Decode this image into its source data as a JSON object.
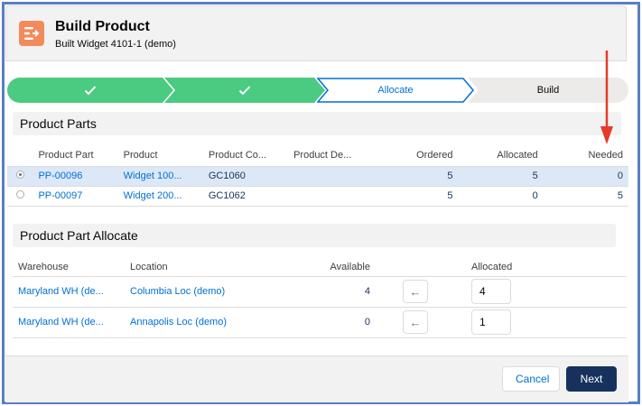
{
  "header": {
    "title": "Build Product",
    "subtitle": "Built Widget 4101-1 (demo)",
    "icon": "build-product-icon"
  },
  "path": {
    "stages": [
      {
        "label": "",
        "state": "complete"
      },
      {
        "label": "",
        "state": "complete"
      },
      {
        "label": "Allocate",
        "state": "current"
      },
      {
        "label": "Build",
        "state": "incomplete"
      }
    ],
    "colors": {
      "complete": "#4bca81",
      "current_border": "#0070d2",
      "incomplete": "#ecebea"
    }
  },
  "parts": {
    "title": "Product Parts",
    "columns": [
      "Product Part",
      "Product",
      "Product Co...",
      "Product De...",
      "Ordered",
      "Allocated",
      "Needed"
    ],
    "rows": [
      {
        "selected": true,
        "part": "PP-00096",
        "product": "Widget 100...",
        "code": "GC1060",
        "desc": "",
        "ordered": "5",
        "allocated": "5",
        "needed": "0"
      },
      {
        "selected": false,
        "part": "PP-00097",
        "product": "Widget 200...",
        "code": "GC1062",
        "desc": "",
        "ordered": "5",
        "allocated": "0",
        "needed": "5"
      }
    ]
  },
  "allocate": {
    "title": "Product Part Allocate",
    "columns": [
      "Warehouse",
      "Location",
      "Available",
      "Allocated"
    ],
    "rows": [
      {
        "warehouse": "Maryland WH (de...",
        "location": "Columbia Loc (demo)",
        "available": "4",
        "qty": "4"
      },
      {
        "warehouse": "Maryland WH (de...",
        "location": "Annapolis Loc (demo)",
        "available": "0",
        "qty": "1"
      }
    ]
  },
  "footer": {
    "cancel_label": "Cancel",
    "next_label": "Next"
  },
  "annotation": {
    "color": "#e53a2c"
  }
}
